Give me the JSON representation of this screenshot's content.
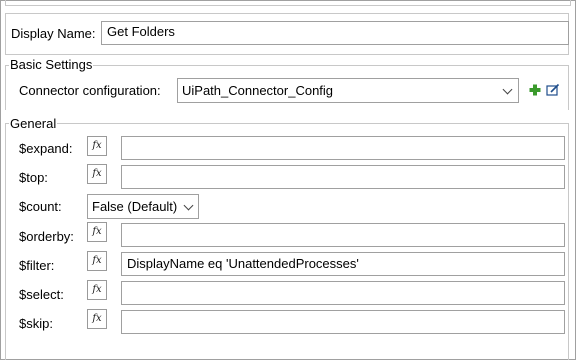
{
  "display_name": {
    "label": "Display Name:",
    "value": "Get Folders"
  },
  "basic_settings": {
    "title": "Basic Settings",
    "connector_label": "Connector configuration:",
    "connector_value": "UiPath_Connector_Config",
    "add_icon": "plus-icon",
    "edit_icon": "edit-icon",
    "add_color": "#3a9a2c",
    "edit_color": "#1f4e8c"
  },
  "general": {
    "title": "General",
    "fx_label": "fx",
    "expand": {
      "label": "$expand:",
      "value": ""
    },
    "top": {
      "label": "$top:",
      "value": ""
    },
    "count": {
      "label": "$count:",
      "value": "False (Default)"
    },
    "orderby": {
      "label": "$orderby:",
      "value": ""
    },
    "filter": {
      "label": "$filter:",
      "value": "DisplayName eq 'UnattendedProcesses'"
    },
    "select": {
      "label": "$select:",
      "value": ""
    },
    "skip": {
      "label": "$skip:",
      "value": ""
    }
  }
}
